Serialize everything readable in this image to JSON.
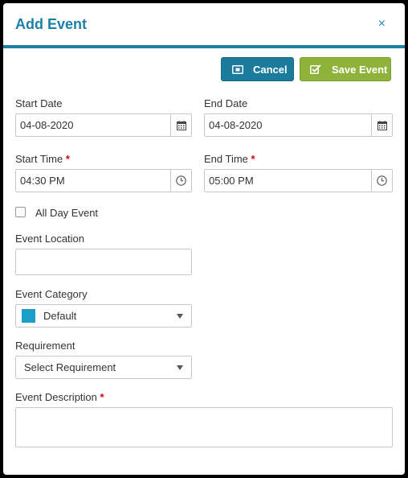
{
  "dialog": {
    "title": "Add Event",
    "close_glyph": "×"
  },
  "buttons": {
    "cancel_label": "Cancel",
    "cancel_icon": "cancel-icon",
    "save_label": "Save Event",
    "save_icon": "check-square-icon"
  },
  "fields": {
    "start_date": {
      "label": "Start Date",
      "value": "04-08-2020",
      "icon": "calendar-icon"
    },
    "end_date": {
      "label": "End Date",
      "value": "04-08-2020",
      "icon": "calendar-icon"
    },
    "start_time": {
      "label": "Start Time",
      "required_mark": "*",
      "value": "04:30 PM",
      "icon": "clock-icon"
    },
    "end_time": {
      "label": "End Time",
      "required_mark": "*",
      "value": "05:00 PM",
      "icon": "clock-icon"
    },
    "all_day": {
      "label": "All Day Event",
      "checked": false
    },
    "location": {
      "label": "Event Location",
      "value": ""
    },
    "category": {
      "label": "Event Category",
      "value": "Default",
      "swatch_color": "#1a9ec7"
    },
    "requirement": {
      "label": "Requirement",
      "value": "Select Requirement"
    },
    "description": {
      "label": "Event Description",
      "required_mark": "*",
      "value": ""
    }
  },
  "colors": {
    "accent": "#1e7fa7",
    "cancel_bg": "#1a7b9c",
    "save_bg": "#8fb33a",
    "required": "#d0021b"
  }
}
